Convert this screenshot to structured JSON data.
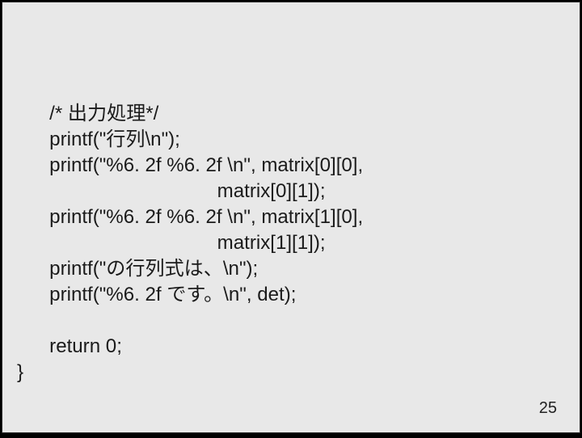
{
  "code": {
    "l1": "      /* 出力処理*/",
    "l2": "      printf(\"行列\\n\");",
    "l3": "      printf(\"%6. 2f %6. 2f \\n\", matrix[0][0],",
    "l4": "                                     matrix[0][1]);",
    "l5": "      printf(\"%6. 2f %6. 2f \\n\", matrix[1][0],",
    "l6": "                                     matrix[1][1]);",
    "l7": "      printf(\"の行列式は、\\n\");",
    "l8": "      printf(\"%6. 2f です。\\n\", det);",
    "l9": "",
    "l10": "      return 0;",
    "l11": "}"
  },
  "page_number": "25"
}
